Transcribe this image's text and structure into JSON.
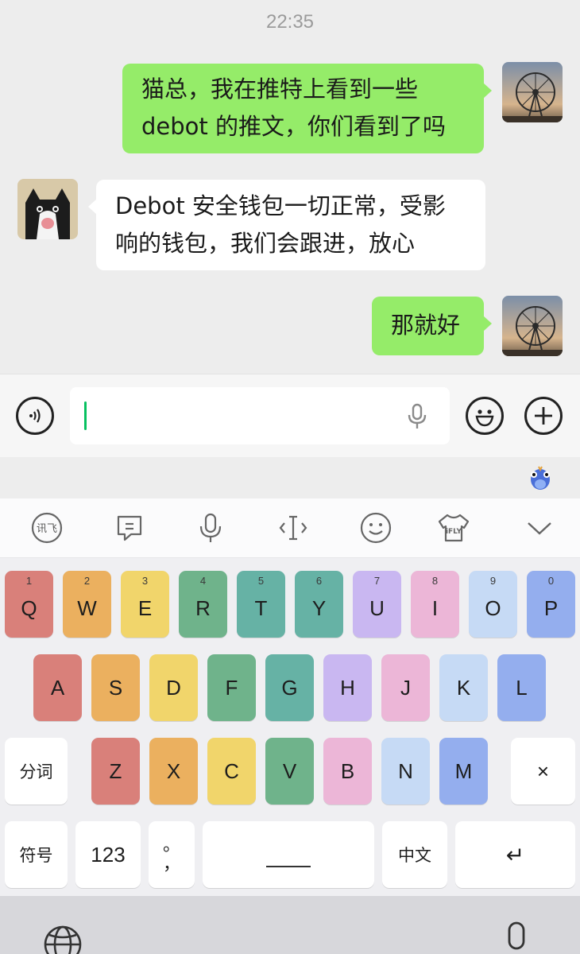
{
  "chat": {
    "time": "22:35",
    "messages": [
      {
        "from": "me",
        "lines": [
          "猫总，我在推特上看到一些",
          "debot 的推文，你们看到了吗"
        ]
      },
      {
        "from": "other",
        "lines": [
          "Debot 安全钱包一切正常，受影",
          "响的钱包，我们会跟进，放心"
        ]
      },
      {
        "from": "me",
        "lines": [
          "那就好"
        ]
      }
    ]
  },
  "input": {
    "voice_toggle_icon": "voice-wave-icon",
    "mic_icon": "mic-icon",
    "emoji_icon": "smiley-icon",
    "plus_icon": "plus-icon"
  },
  "keyboard": {
    "toolbar_icons": [
      "xunfei-logo-icon",
      "clipboard-icon",
      "mic-icon",
      "cursor-icon",
      "emoji-icon",
      "skin-shirt-icon",
      "collapse-chevron-icon"
    ],
    "toolbar_logo_text": "讯飞",
    "skin_text": "iFLY",
    "row1": [
      {
        "num": "1",
        "letter": "Q",
        "color": "#d9807a"
      },
      {
        "num": "2",
        "letter": "W",
        "color": "#ebb05f"
      },
      {
        "num": "3",
        "letter": "E",
        "color": "#f1d56b"
      },
      {
        "num": "4",
        "letter": "R",
        "color": "#6fb38b"
      },
      {
        "num": "5",
        "letter": "T",
        "color": "#66b2a5"
      },
      {
        "num": "6",
        "letter": "Y",
        "color": "#66b2a5"
      },
      {
        "num": "7",
        "letter": "U",
        "color": "#c9b7f1"
      },
      {
        "num": "8",
        "letter": "I",
        "color": "#ecb6d7"
      },
      {
        "num": "9",
        "letter": "O",
        "color": "#c6daf5"
      },
      {
        "num": "0",
        "letter": "P",
        "color": "#94aeee"
      }
    ],
    "row2": [
      {
        "letter": "A",
        "color": "#d9807a"
      },
      {
        "letter": "S",
        "color": "#ebb05f"
      },
      {
        "letter": "D",
        "color": "#f1d56b"
      },
      {
        "letter": "F",
        "color": "#6fb38b"
      },
      {
        "letter": "G",
        "color": "#66b2a5"
      },
      {
        "letter": "H",
        "color": "#c9b7f1"
      },
      {
        "letter": "J",
        "color": "#ecb6d7"
      },
      {
        "letter": "K",
        "color": "#c6daf5"
      },
      {
        "letter": "L",
        "color": "#94aeee"
      }
    ],
    "row3": {
      "left_label": "分词",
      "keys": [
        {
          "letter": "Z",
          "color": "#d9807a"
        },
        {
          "letter": "X",
          "color": "#ebb05f"
        },
        {
          "letter": "C",
          "color": "#f1d56b"
        },
        {
          "letter": "V",
          "color": "#6fb38b"
        },
        {
          "letter": "B",
          "color": "#ecb6d7"
        },
        {
          "letter": "N",
          "color": "#c6daf5"
        },
        {
          "letter": "M",
          "color": "#94aeee"
        }
      ],
      "delete_label": "×"
    },
    "row4": {
      "symbols_label": "符号",
      "numbers_label": "123",
      "punct_top": "。",
      "punct_bottom": "，",
      "space_label": "",
      "lang_label": "中文",
      "return_label": "↵"
    },
    "bottom_icons": [
      "globe-icon",
      "mic-icon"
    ]
  }
}
